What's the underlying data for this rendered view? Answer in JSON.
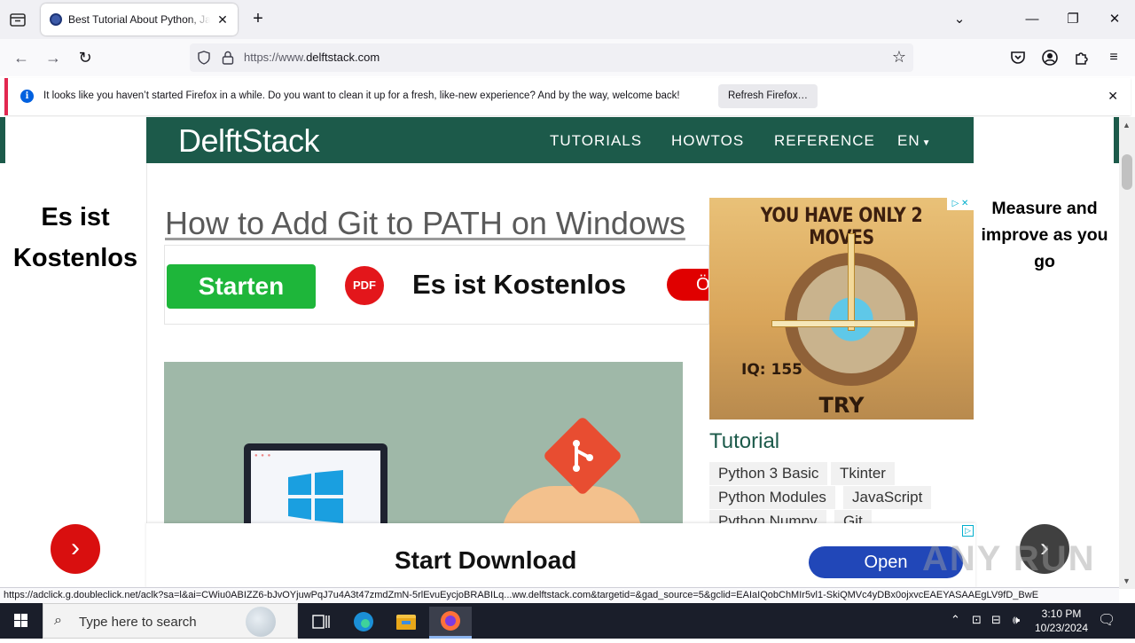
{
  "browser": {
    "tab_title": "Best Tutorial About Python, Javascript, C++, GIT, and more – Delft Stack",
    "url_prefix": "https://www.",
    "url_domain": "delftstack.com",
    "notification": {
      "message": "It looks like you haven’t started Firefox in a while. Do you want to clean it up for a fresh, like-new experience? And by the way, welcome back!",
      "button_label": "Refresh Firefox…"
    },
    "status_url": "https://adclick.g.doubleclick.net/aclk?sa=l&ai=CWiu0ABIZZ6-bJvOYjuwPqJ7u4A3t47zmdZmN-5rlEvuEycjoBRABILq...ww.delftstack.com&targetid=&gad_source=5&gclid=EAIaIQobChMIr5vl1-SkiQMVc4yDBx0ojxvcEAEYASAAEgLV9fD_BwE"
  },
  "site": {
    "logo": "DelftStack",
    "nav": [
      "TUTORIALS",
      "HOWTOS",
      "REFERENCE",
      "EN"
    ],
    "article_title": "How to Add Git to PATH on Windows",
    "left_ad_text": "Es ist Kostenlos",
    "right_ad_text": "Measure and improve as you go",
    "inline_ad": {
      "button": "Starten",
      "pdf_label": "PDF",
      "headline": "Es ist Kostenlos",
      "pill_text": "Ö"
    },
    "square_ad": {
      "headline": "YOU HAVE ONLY 2 MOVES",
      "iq": "IQ: 155",
      "cta": "TRY"
    },
    "tutorial_heading": "Tutorial",
    "tutorial_chips": [
      "Python 3 Basic",
      "Tkinter",
      "Python Modules",
      "JavaScript",
      "Python Numpy",
      "Git"
    ],
    "bottom_ad": {
      "headline": "Start Download",
      "button": "Open"
    },
    "watermark": "ANY RUN"
  },
  "taskbar": {
    "search_placeholder": "Type here to search",
    "time": "3:10 PM",
    "date": "10/23/2024"
  }
}
